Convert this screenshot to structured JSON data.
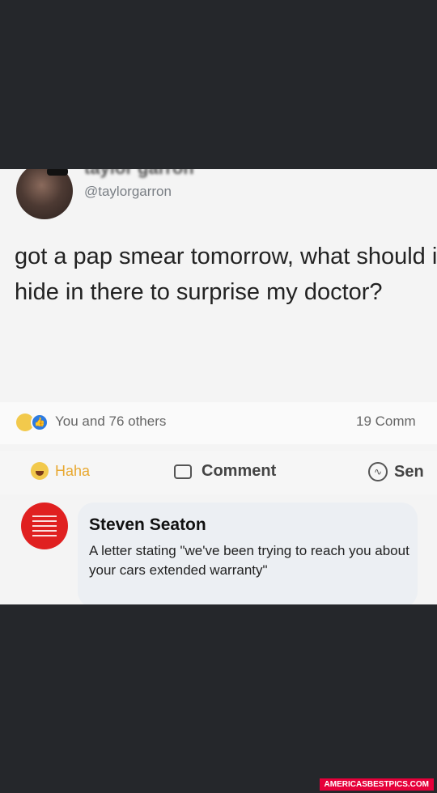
{
  "tweet": {
    "display_name": "taylor garron",
    "handle": "@taylorgarron",
    "text": "got a pap smear tomorrow, what should i hide in there to surprise my doctor?"
  },
  "reactions": {
    "summary": "You and 76 others",
    "comments_count": "19 Comm",
    "icons": [
      "haha-emoji",
      "like-icon"
    ]
  },
  "actions": {
    "haha_label": "Haha",
    "comment_label": "Comment",
    "send_label": "Sen"
  },
  "comment": {
    "author": "Steven Seaton",
    "text": "A letter stating \"we've been trying to reach you about your cars extended warranty\""
  },
  "watermark": "AMERICASBESTPICS.COM",
  "colors": {
    "background": "#25272b",
    "haha": "#e8a830",
    "like": "#2d7be0",
    "avatar_red": "#e02020",
    "watermark": "#e6003a"
  }
}
